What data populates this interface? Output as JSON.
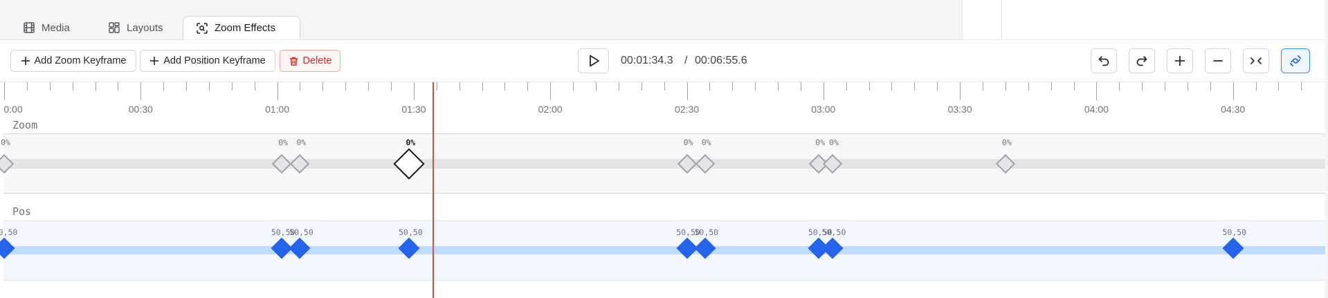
{
  "tabs": [
    {
      "label": "Media",
      "icon": "film-icon"
    },
    {
      "label": "Layouts",
      "icon": "layout-grid-icon"
    },
    {
      "label": "Zoom Effects",
      "icon": "zoom-scan-icon",
      "active": true
    }
  ],
  "toolbar": {
    "add_zoom_label": "Add Zoom Keyframe",
    "add_position_label": "Add Position Keyframe",
    "delete_label": "Delete",
    "current_time": "00:01:34.3",
    "separator": "/",
    "total_time": "00:06:55.6",
    "icons": [
      "play-icon",
      "undo-icon",
      "redo-icon",
      "zoom-in-icon",
      "zoom-out-icon",
      "fit-icon",
      "snap-icon"
    ]
  },
  "ruler": {
    "labels": [
      "0:00",
      "00:30",
      "01:00",
      "01:30",
      "02:00",
      "02:30",
      "03:00",
      "03:30",
      "04:00",
      "04:30"
    ]
  },
  "tracks": {
    "zoom": {
      "label": "Zoom",
      "keyframes": [
        {
          "time_s": 0,
          "label": "0%"
        },
        {
          "time_s": 61,
          "label": "0%"
        },
        {
          "time_s": 65,
          "label": "0%"
        },
        {
          "time_s": 89,
          "label": "0%",
          "selected": true
        },
        {
          "time_s": 150,
          "label": "0%"
        },
        {
          "time_s": 154,
          "label": "0%"
        },
        {
          "time_s": 179,
          "label": "0%"
        },
        {
          "time_s": 182,
          "label": "0%"
        },
        {
          "time_s": 220,
          "label": "0%"
        }
      ]
    },
    "pos": {
      "label": "Pos",
      "keyframes": [
        {
          "time_s": 0,
          "label": "50,50"
        },
        {
          "time_s": 61,
          "label": "50,50"
        },
        {
          "time_s": 65,
          "label": "50,50"
        },
        {
          "time_s": 89,
          "label": "50,50"
        },
        {
          "time_s": 150,
          "label": "50,50"
        },
        {
          "time_s": 154,
          "label": "50,50"
        },
        {
          "time_s": 179,
          "label": "50,50"
        },
        {
          "time_s": 182,
          "label": "50,50"
        },
        {
          "time_s": 270,
          "label": "50,50"
        }
      ]
    }
  },
  "playhead_time_s": 94.3,
  "colors": {
    "accent": "#2563eb",
    "playhead": "#ef4444",
    "danger": "#dc2626"
  }
}
